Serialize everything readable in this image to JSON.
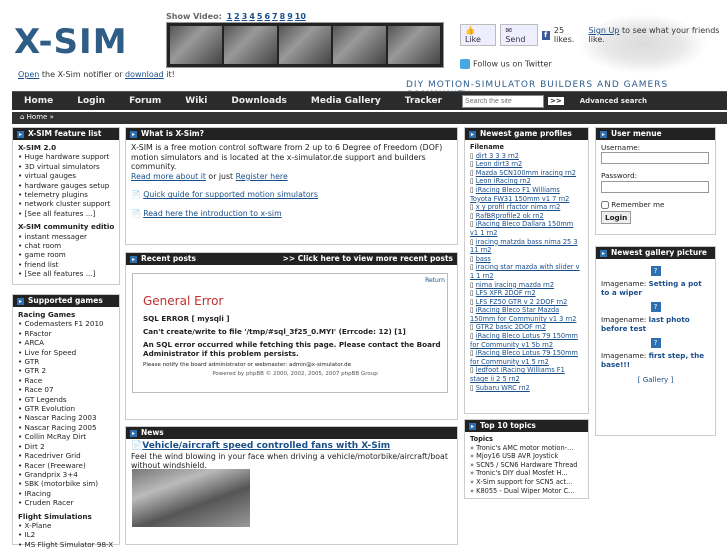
{
  "header": {
    "logo_text": "X-SIM",
    "notifier_open": "Open",
    "notifier_mid": " the X-Sim notifier or ",
    "notifier_download": "download",
    "notifier_end": " it!",
    "show_video_label": "Show Video:",
    "video_numbers": [
      "1",
      "2",
      "3",
      "4",
      "5",
      "6",
      "7",
      "8",
      "9",
      "10"
    ],
    "like": "Like",
    "send": "Send",
    "likes_count": "25 likes.",
    "signup": "Sign Up",
    "signup_rest": " to see what your friends like.",
    "twitter": "Follow us on  Twitter",
    "tagline": "DIY MOTION-SIMULATOR BUILDERS AND GAMERS COMMUNITY"
  },
  "nav": {
    "items": [
      "Home",
      "Login",
      "Forum",
      "Wiki",
      "Downloads",
      "Media Gallery",
      "Tracker"
    ],
    "search_placeholder": "Search the site",
    "go": ">>",
    "advanced": "Advanced search"
  },
  "breadcrumb": "Home »",
  "feature_list": {
    "title": "X-SIM feature list",
    "s1_title": "X-SIM 2.0",
    "s1_items": [
      "Huge hardware support",
      "3D virtual simulators",
      "virtual gauges",
      "hardware gauges setup",
      "telemetry plugins",
      "network cluster support",
      "[See all features ...]"
    ],
    "s2_title": "X-SIM community edition",
    "s2_items": [
      "instant messager",
      "chat room",
      "game room",
      "friend list",
      "[See all features ...]"
    ]
  },
  "supported": {
    "title": "Supported games",
    "s1_title": "Racing Games",
    "s1_items": [
      "Codemasters F1 2010",
      "RFactor",
      "ARCA",
      "Live for Speed",
      "GTR",
      "GTR 2",
      "Race",
      "Race 07",
      "GT Legends",
      "GTR Evolution",
      "Nascar Racing 2003",
      "Nascar Racing 2005",
      "Collin McRay Dirt",
      "Dirt 2",
      "Racedriver Grid",
      "Racer (Freeware)",
      "Grandprix 3+4",
      "SBK (motorbike sim)",
      "IRacing",
      "Cruden Racer"
    ],
    "s2_title": "Flight Simulations",
    "s2_items": [
      "X-Plane",
      "IL2",
      "MS Flight Simulator 98-X"
    ]
  },
  "whatis": {
    "title": "What is X-Sim?",
    "text": "X-SIM is a free motion control software from 2 up to 6 Degree of Freedom (DOF) motion simulators and is located at the x-simulator.de support and builders community.",
    "read_more": "Read more about it",
    "or": " or just ",
    "register": "Register here",
    "guide": "Quick guide for supported motion simulators",
    "intro": "Read here the introduction to x-sim"
  },
  "recent": {
    "title": "Recent posts",
    "view_more": ">> Click here to view more recent posts",
    "return": "Return",
    "error_title": "General Error",
    "sql_error": "SQL ERROR [ mysqli ]",
    "cant_create": "Can't create/write to file '/tmp/#sql_3f25_0.MYI' (Errcode: 12) [1]",
    "sql_msg": "An SQL error occurred while fetching this page. Please contact the Board Administrator if this problem persists.",
    "notify": "Please notify the board administrator or webmaster: admin@x-simulator.de",
    "powered": "Powered by phpBB © 2000, 2002, 2005, 2007 phpBB Group"
  },
  "news": {
    "title": "News",
    "headline": "Vehicle/aircraft speed controlled fans with X-Sim",
    "text": "Feel the wind blowing in your face when driving a vehicle/motorbike/aircraft/boat without windshield."
  },
  "profiles": {
    "title": "Newest game profiles",
    "header": "Filename",
    "items": [
      "dirt 3 3 3 rn2",
      "Leon dirt3 rn2",
      "Mazda SCN100mm iracing rn2",
      "Leon iRacing rn2",
      "iRacing Bleco F1 Williams Toyota FW31 150mm v1 7 rn2",
      "x y profil rfactor nima rn2",
      "RafBRprofile2 ok rn2",
      "iRacing Bleco Dallara 150mm v1 1 rn2",
      "iracing matzda bass nima 25 3 11 rn2",
      "bass",
      "iracing star mazda with slider v 1 1 rn2",
      "nima iracing mazda rn2",
      "LFS XFR 2DOF rn2",
      "LFS FZ50 GTR v 2 2DOF rn2",
      "iRacing Bleco Star Mazda 150mm for Community v1 3 rn2",
      "GTR2 basic 2DOF rn2",
      "iRacing Bleco Lotus 79 150mm for Community v1 5b rn2",
      "iRacing Bleco Lotus 79 150mm for Community v1 5 rn2",
      "ledfoot iRacing Williams F1 stage ii 2 5 rn2",
      "Subaru WRC rn2"
    ]
  },
  "top10": {
    "title": "Top 10 topics",
    "header": "Topics",
    "items": [
      "Tronic's AMC motor motion-...",
      "Mjoy16 USB AVR Joystick",
      "SCN5 / SCN6 Hardware Thread",
      "Tronic's DIY dual Mosfet H...",
      "X-Sim support for SCN5 act...",
      "K8055 - Dual Wiper Motor C..."
    ]
  },
  "user": {
    "title": "User menue",
    "username": "Username:",
    "password": "Password:",
    "remember": "Remember me",
    "login": "Login"
  },
  "gallery": {
    "title": "Newest gallery picture",
    "label": "Imagename:",
    "items": [
      "Setting a pot to a wiper",
      "last photo before test",
      "first step, the base!!!"
    ],
    "link": "[ Gallery ]"
  }
}
